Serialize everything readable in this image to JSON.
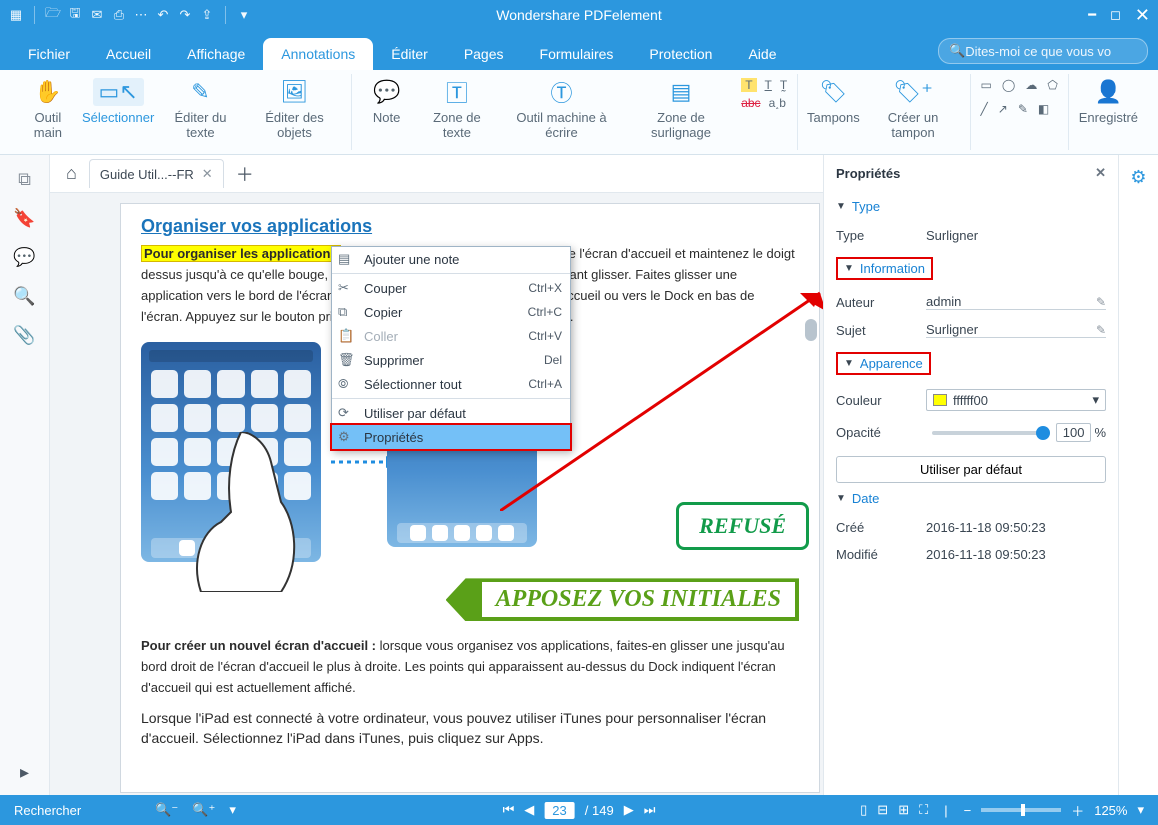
{
  "title": "Wondershare PDFelement",
  "menu": {
    "fichier": "Fichier",
    "accueil": "Accueil",
    "affichage": "Affichage",
    "annotations": "Annotations",
    "editer": "Éditer",
    "pages": "Pages",
    "formulaires": "Formulaires",
    "protection": "Protection",
    "aide": "Aide"
  },
  "search_placeholder": "Dites-moi ce que vous vo",
  "ribbon": {
    "main": "Outil main",
    "select": "Sélectionner",
    "edit_text": "Éditer du texte",
    "edit_obj": "Éditer des objets",
    "note": "Note",
    "textbox": "Zone de texte",
    "typewriter": "Outil machine à écrire",
    "highlight": "Zone de surlignage",
    "stamps": "Tampons",
    "create_stamp": "Créer un tampon",
    "register": "Enregistré"
  },
  "tab": {
    "name": "Guide Util...--FR"
  },
  "doc": {
    "heading": "Organiser vos applications",
    "hl": "Pour organiser les applications",
    "p1": " : touchez n'importe quelle application de l'écran d'accueil et maintenez le doigt dessus jusqu'à ce qu'elle bouge, puis déplacez vos applications en les faisant glisser. Faites glisser une application vers le bord de l'écran pour la déplacer vers un autre écran d'accueil ou vers le Dock en bas de l'écran. Appuyez sur le bouton principal pour enregistrer votre agencement.",
    "stamp_ref": "REFUSÉ",
    "stamp_init": "APPOSEZ VOS INITIALES",
    "p2a": "Pour créer un nouvel écran d'accueil :",
    "p2b": " lorsque vous organisez vos applications, faites-en glisser une jusqu'au bord droit de l'écran d'accueil le plus à droite. Les points qui apparaissent au-dessus du Dock indiquent l'écran d'accueil qui est actuellement affiché.",
    "p3": "Lorsque l'iPad est connecté à votre ordinateur, vous pouvez utiliser iTunes pour personnaliser l'écran d'accueil. Sélectionnez l'iPad dans iTunes, puis cliquez sur Apps."
  },
  "ctx": {
    "add_note": "Ajouter une note",
    "cut": "Couper",
    "copy": "Copier",
    "paste": "Coller",
    "delete": "Supprimer",
    "select_all": "Sélectionner tout",
    "use_default": "Utiliser par défaut",
    "props": "Propriétés",
    "sc_cut": "Ctrl+X",
    "sc_copy": "Ctrl+C",
    "sc_paste": "Ctrl+V",
    "sc_del": "Del",
    "sc_selall": "Ctrl+A"
  },
  "props": {
    "title": "Propriétés",
    "type_h": "Type",
    "type_lab": "Type",
    "type_val": "Surligner",
    "info_h": "Information",
    "author_lab": "Auteur",
    "author_val": "admin",
    "subject_lab": "Sujet",
    "subject_val": "Surligner",
    "appear_h": "Apparence",
    "color_lab": "Couleur",
    "color_val": "ffffff00",
    "opacity_lab": "Opacité",
    "opacity_val": "100",
    "opacity_pct": "%",
    "btn_default": "Utiliser par défaut",
    "date_h": "Date",
    "created_lab": "Créé",
    "created_val": "2016-11-18 09:50:23",
    "modified_lab": "Modifié",
    "modified_val": "2016-11-18 09:50:23"
  },
  "status": {
    "find": "Rechercher",
    "page": "23",
    "total": "/ 149",
    "zoom": "125%"
  }
}
